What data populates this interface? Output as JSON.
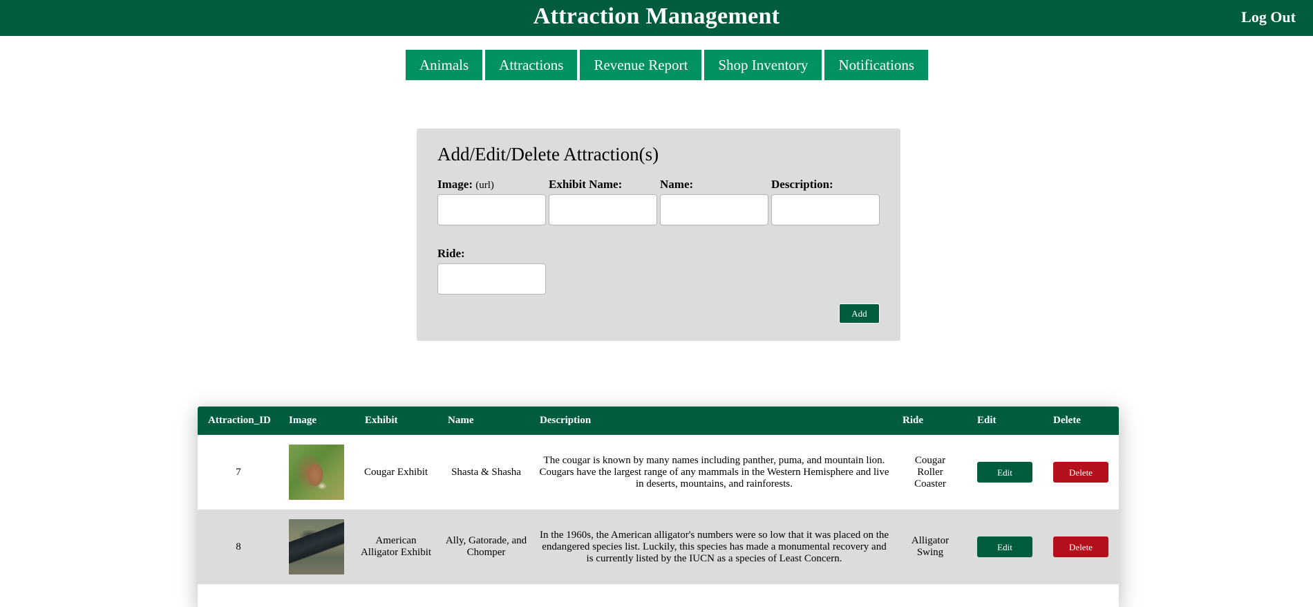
{
  "header": {
    "title": "Attraction Management",
    "logout_label": "Log Out"
  },
  "nav": {
    "items": [
      {
        "label": "Animals"
      },
      {
        "label": "Attractions"
      },
      {
        "label": "Revenue Report"
      },
      {
        "label": "Shop Inventory"
      },
      {
        "label": "Notifications"
      }
    ]
  },
  "form": {
    "title": "Add/Edit/Delete Attraction(s)",
    "image_label": "Image:",
    "image_sublabel": "(url)",
    "exhibit_label": "Exhibit Name:",
    "name_label": "Name:",
    "description_label": "Description:",
    "ride_label": "Ride:",
    "image_value": "",
    "exhibit_value": "",
    "name_value": "",
    "description_value": "",
    "ride_value": "",
    "add_label": "Add"
  },
  "table": {
    "headers": {
      "id": "Attraction_ID",
      "image": "Image",
      "exhibit": "Exhibit",
      "name": "Name",
      "description": "Description",
      "ride": "Ride",
      "edit": "Edit",
      "delete": "Delete"
    },
    "rows": [
      {
        "id": "7",
        "image": "cougar-photo",
        "exhibit": "Cougar Exhibit",
        "name": "Shasta & Shasha",
        "description": "The cougar is known by many names including panther, puma, and mountain lion. Cougars have the largest range of any mammals in the Western Hemisphere and live in deserts, mountains, and rainforests.",
        "ride": "Cougar Roller Coaster",
        "edit_label": "Edit",
        "delete_label": "Delete"
      },
      {
        "id": "8",
        "image": "alligator-photo",
        "exhibit": "American Alligator Exhibit",
        "name": "Ally, Gatorade, and Chomper",
        "description": "In the 1960s, the American alligator's numbers were so low that it was placed on the endangered species list. Luckily, this species has made a monumental recovery and is currently listed by the IUCN as a species of Least Concern.",
        "ride": "Alligator Swing",
        "edit_label": "Edit",
        "delete_label": "Delete"
      }
    ]
  },
  "colors": {
    "header_green": "#005c3e",
    "nav_green": "#029161",
    "panel_gray": "#dcdcdc",
    "delete_red": "#b3101b"
  }
}
